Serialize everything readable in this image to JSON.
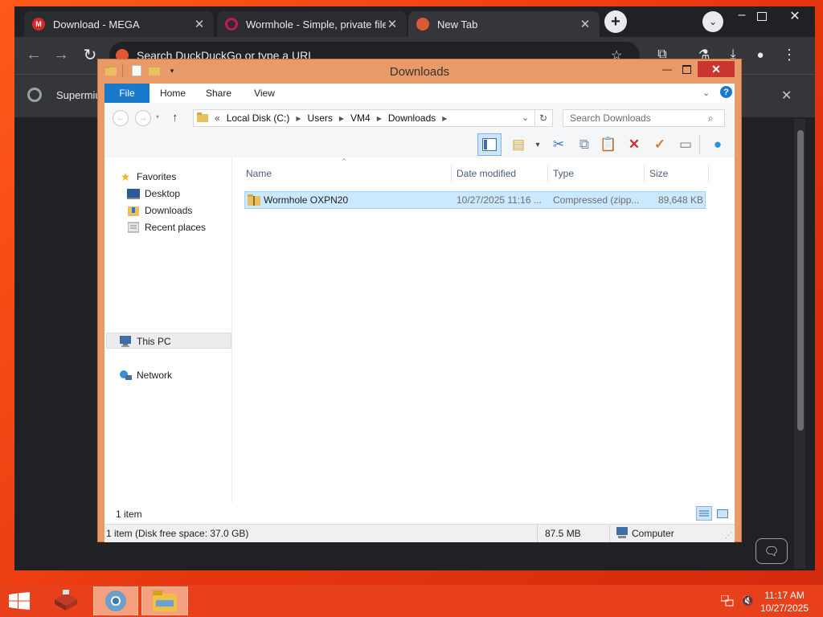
{
  "browser": {
    "tabs": [
      {
        "label": "Download - MEGA",
        "favicon": "M",
        "favicon_color": "#d9272e",
        "active": false
      },
      {
        "label": "Wormhole - Simple, private file",
        "favicon": "",
        "favicon_color": "#c2185b",
        "active": false
      },
      {
        "label": "New Tab",
        "favicon": "",
        "favicon_color": "#de5833",
        "active": true
      }
    ],
    "omnibox_placeholder": "Search DuckDuckGo or type a URL",
    "bookmark_label": "Supermiu",
    "close_glyph": "✕"
  },
  "explorer": {
    "title": "Downloads",
    "ribbon_tabs": [
      "File",
      "Home",
      "Share",
      "View"
    ],
    "address": {
      "prefix": "«",
      "crumbs": [
        "Local Disk (C:)",
        "Users",
        "VM4",
        "Downloads"
      ]
    },
    "search_placeholder": "Search Downloads",
    "nav": {
      "favorites": "Favorites",
      "desktop": "Desktop",
      "downloads": "Downloads",
      "recent": "Recent places",
      "this_pc": "This PC",
      "network": "Network"
    },
    "columns": {
      "name": "Name",
      "date": "Date modified",
      "type": "Type",
      "size": "Size"
    },
    "files": [
      {
        "name": "Wormhole OXPN20",
        "date": "10/27/2025 11:16 ...",
        "type": "Compressed (zipp...",
        "size": "89,648 KB"
      }
    ],
    "status_count": "1 item",
    "details_left": "1 item (Disk free space: 37.0 GB)",
    "details_size": "87.5 MB",
    "details_location": "Computer"
  },
  "taskbar": {
    "time": "11:17 AM",
    "date": "10/27/2025"
  },
  "colors": {
    "accent": "#1979ca",
    "selection": "#cce8ff",
    "taskbar": "#e8401a",
    "window_frame": "#e89a68"
  }
}
